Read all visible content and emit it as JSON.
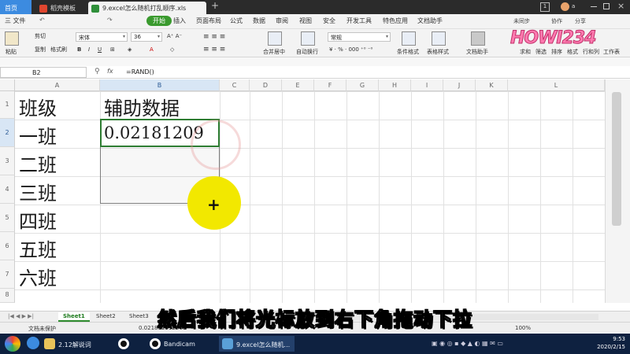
{
  "tabs": {
    "home": "首页",
    "doc": "稻壳模板",
    "active": "9.excel怎么随机打乱顺序.xls",
    "plus": "+"
  },
  "window": {
    "badge": "1",
    "user": "a"
  },
  "menu": {
    "file": "三 文件",
    "start": "开始",
    "items": [
      "插入",
      "页面布局",
      "公式",
      "数据",
      "审阅",
      "视图",
      "安全",
      "开发工具",
      "特色应用",
      "文档助手"
    ],
    "upload": "未同步",
    "share": "协作",
    "share2": "分享"
  },
  "ribbon": {
    "paste": "粘贴",
    "cut": "剪切",
    "copy": "复制",
    "format_painter": "格式刷",
    "font_name": "宋体",
    "font_size": "36",
    "merge": "合并居中",
    "wrap": "自动换行",
    "number_format": "常规",
    "cond_format": "条件格式",
    "table_style": "表格样式",
    "doc_helper": "文档助手",
    "sum": "求和",
    "filter": "筛选",
    "sort": "排序",
    "format": "格式",
    "rowcol": "行和列",
    "worksheet": "工作表"
  },
  "formula_bar": {
    "cell_ref": "B2",
    "fx": "fx",
    "formula": "=RAND()"
  },
  "columns": [
    "A",
    "B",
    "C",
    "D",
    "E",
    "F",
    "G",
    "H",
    "I",
    "J",
    "K",
    "L"
  ],
  "rows": [
    "1",
    "2",
    "3",
    "4",
    "5",
    "6",
    "7",
    "8"
  ],
  "cells": {
    "A1": "班级",
    "B1": "辅助数据",
    "A2": "一班",
    "B2": "0.02181209",
    "A3": "二班",
    "A4": "三班",
    "A5": "四班",
    "A6": "五班",
    "A7": "六班"
  },
  "sheets": [
    "Sheet1",
    "Sheet2",
    "Sheet3"
  ],
  "sheet_add": "+",
  "status": {
    "protect": "文档未保护",
    "value": "0.021812092648",
    "zoom": "100%"
  },
  "subtitle": "然后我们将光标放到右下角拖动下拉",
  "watermark": "HOWI234",
  "taskbar": {
    "items": [
      "2.12解说词",
      "Bandicam",
      "9.excel怎么随机..."
    ],
    "time": "9:53",
    "date": "2020/2/15"
  },
  "colors": {
    "accent_green": "#3a9a2e",
    "selection": "#2e7d32",
    "cursor": "#f2e800",
    "taskbar": "#0e2140"
  }
}
